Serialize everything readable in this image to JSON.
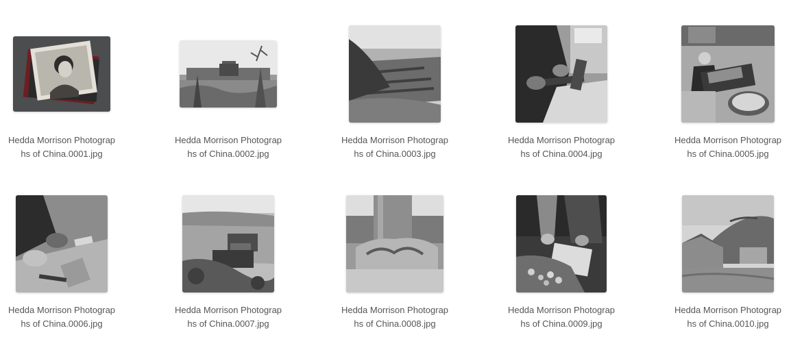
{
  "files": [
    {
      "name": "Hedda Morrison Photographs of China.0001.jpg",
      "line1": "Hedda Morrison Photograp",
      "line2": "hs of China.0001.jpg",
      "subject": "portrait-book"
    },
    {
      "name": "Hedda Morrison Photographs of China.0002.jpg",
      "line1": "Hedda Morrison Photograp",
      "line2": "hs of China.0002.jpg",
      "subject": "gateway-landscape"
    },
    {
      "name": "Hedda Morrison Photographs of China.0003.jpg",
      "line1": "Hedda Morrison Photograp",
      "line2": "hs of China.0003.jpg",
      "subject": "terraced-fields"
    },
    {
      "name": "Hedda Morrison Photographs of China.0004.jpg",
      "line1": "Hedda Morrison Photograp",
      "line2": "hs of China.0004.jpg",
      "subject": "hands-working"
    },
    {
      "name": "Hedda Morrison Photographs of China.0005.jpg",
      "line1": "Hedda Morrison Photograp",
      "line2": "hs of China.0005.jpg",
      "subject": "street-vendor"
    },
    {
      "name": "Hedda Morrison Photographs of China.0006.jpg",
      "line1": "Hedda Morrison Photograp",
      "line2": "hs of China.0006.jpg",
      "subject": "craftsman-hands"
    },
    {
      "name": "Hedda Morrison Photographs of China.0007.jpg",
      "line1": "Hedda Morrison Photograp",
      "line2": "hs of China.0007.jpg",
      "subject": "village-valley"
    },
    {
      "name": "Hedda Morrison Photographs of China.0008.jpg",
      "line1": "Hedda Morrison Photograp",
      "line2": "hs of China.0008.jpg",
      "subject": "stone-column"
    },
    {
      "name": "Hedda Morrison Photographs of China.0009.jpg",
      "line1": "Hedda Morrison Photograp",
      "line2": "hs of China.0009.jpg",
      "subject": "woodcarving"
    },
    {
      "name": "Hedda Morrison Photographs of China.0010.jpg",
      "line1": "Hedda Morrison Photograp",
      "line2": "hs of China.0010.jpg",
      "subject": "farmhouse-hill"
    }
  ]
}
